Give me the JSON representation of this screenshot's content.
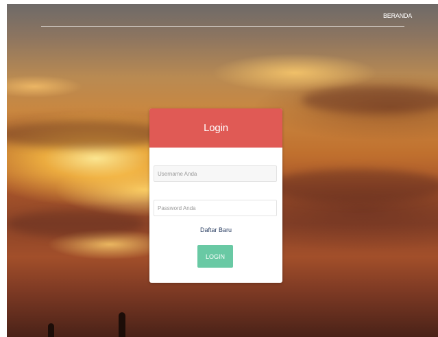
{
  "nav": {
    "home_label": "BERANDA"
  },
  "login": {
    "title": "Login",
    "username_placeholder": "Username Anda",
    "password_placeholder": "Password Anda",
    "register_label": "Daftar Baru",
    "submit_label": "LOGIN"
  },
  "colors": {
    "header_red": "#e05a55",
    "button_green": "#69c9a4",
    "link_navy": "#2b3f63"
  }
}
